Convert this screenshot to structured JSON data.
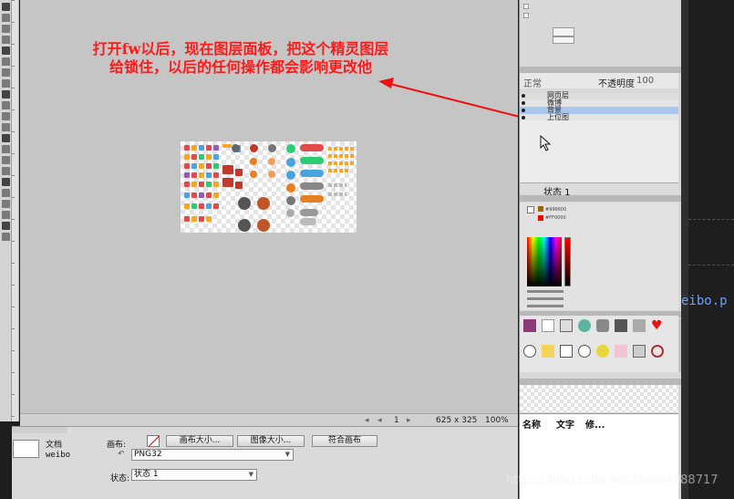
{
  "annotation": {
    "line1": "打开fw以后，现在图层面板，把这个精灵图层",
    "line2": "给锁住，以后的任何操作都会影响更改他"
  },
  "status_bar": {
    "page_number": "1",
    "dimensions": "625 x 325",
    "zoom": "100%"
  },
  "properties": {
    "doc_label": "文档",
    "doc_name": "weibo",
    "canvas_label": "画布:",
    "canvas_size_button": "画布大小...",
    "image_size_button": "图像大小...",
    "fit_canvas_button": "符合画布",
    "format_value": "PNG32",
    "state_label": "状态:",
    "state_value": "状态 1"
  },
  "layers": {
    "blend_mode": "正常",
    "opacity_label": "不透明度",
    "opacity_value": "100",
    "rows": [
      {
        "label": "网页层"
      },
      {
        "label": "微博"
      },
      {
        "label": "背景"
      },
      {
        "label": "上位图"
      }
    ],
    "state_label": "状态 1"
  },
  "colors": {
    "hex1": "#996600",
    "hex2": "#FF0000"
  },
  "table_panel": {
    "col_name": "名称",
    "col_text": "文字",
    "col_more": "修..."
  },
  "outside": {
    "code_fragment": "eibo.p"
  },
  "watermark": "https://blog.csdn.net/steve4988717",
  "accent_colors": {
    "annotation": "#ff1a1a",
    "canvas_bg": "#c5c5c5",
    "panel_bg": "#d8d8d8"
  }
}
